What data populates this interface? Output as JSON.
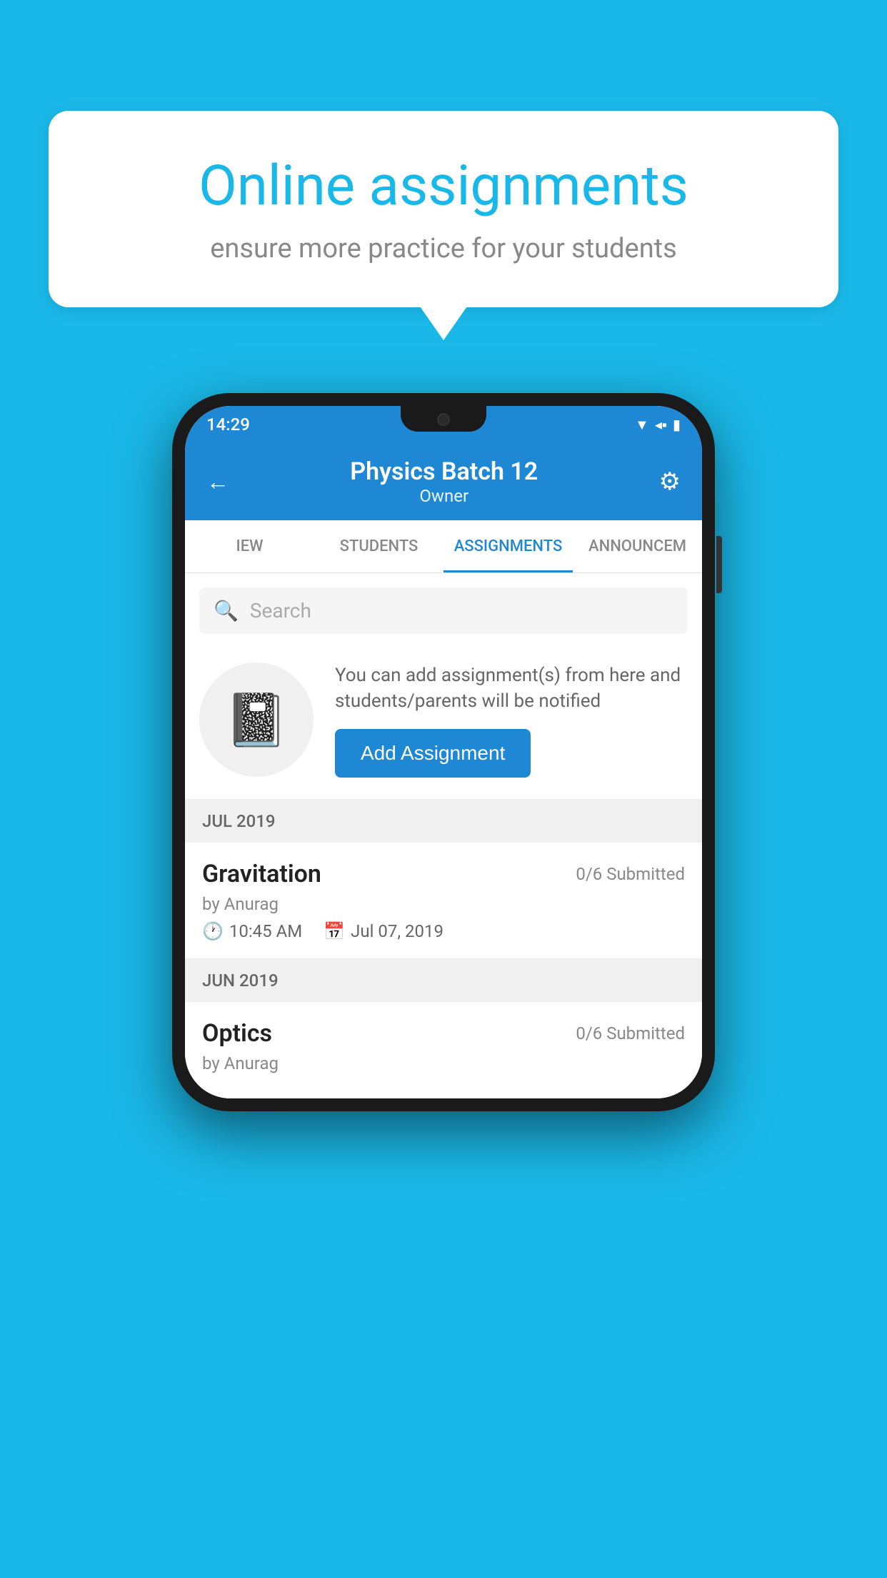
{
  "background": {
    "color": "#1ab8e8"
  },
  "speech_bubble": {
    "title": "Online assignments",
    "subtitle": "ensure more practice for your students"
  },
  "phone": {
    "status_bar": {
      "time": "14:29",
      "icons": [
        "wifi",
        "signal",
        "battery"
      ]
    },
    "header": {
      "title": "Physics Batch 12",
      "subtitle": "Owner",
      "back_label": "←",
      "settings_label": "⚙"
    },
    "tabs": [
      {
        "label": "IEW",
        "active": false
      },
      {
        "label": "STUDENTS",
        "active": false
      },
      {
        "label": "ASSIGNMENTS",
        "active": true
      },
      {
        "label": "ANNOUNCEM",
        "active": false
      }
    ],
    "search": {
      "placeholder": "Search"
    },
    "promo": {
      "description": "You can add assignment(s) from here and students/parents will be notified",
      "add_button_label": "Add Assignment"
    },
    "sections": [
      {
        "label": "JUL 2019",
        "assignments": [
          {
            "title": "Gravitation",
            "submitted": "0/6 Submitted",
            "by": "by Anurag",
            "time": "10:45 AM",
            "date": "Jul 07, 2019"
          }
        ]
      },
      {
        "label": "JUN 2019",
        "assignments": [
          {
            "title": "Optics",
            "submitted": "0/6 Submitted",
            "by": "by Anurag",
            "time": "",
            "date": ""
          }
        ]
      }
    ]
  }
}
